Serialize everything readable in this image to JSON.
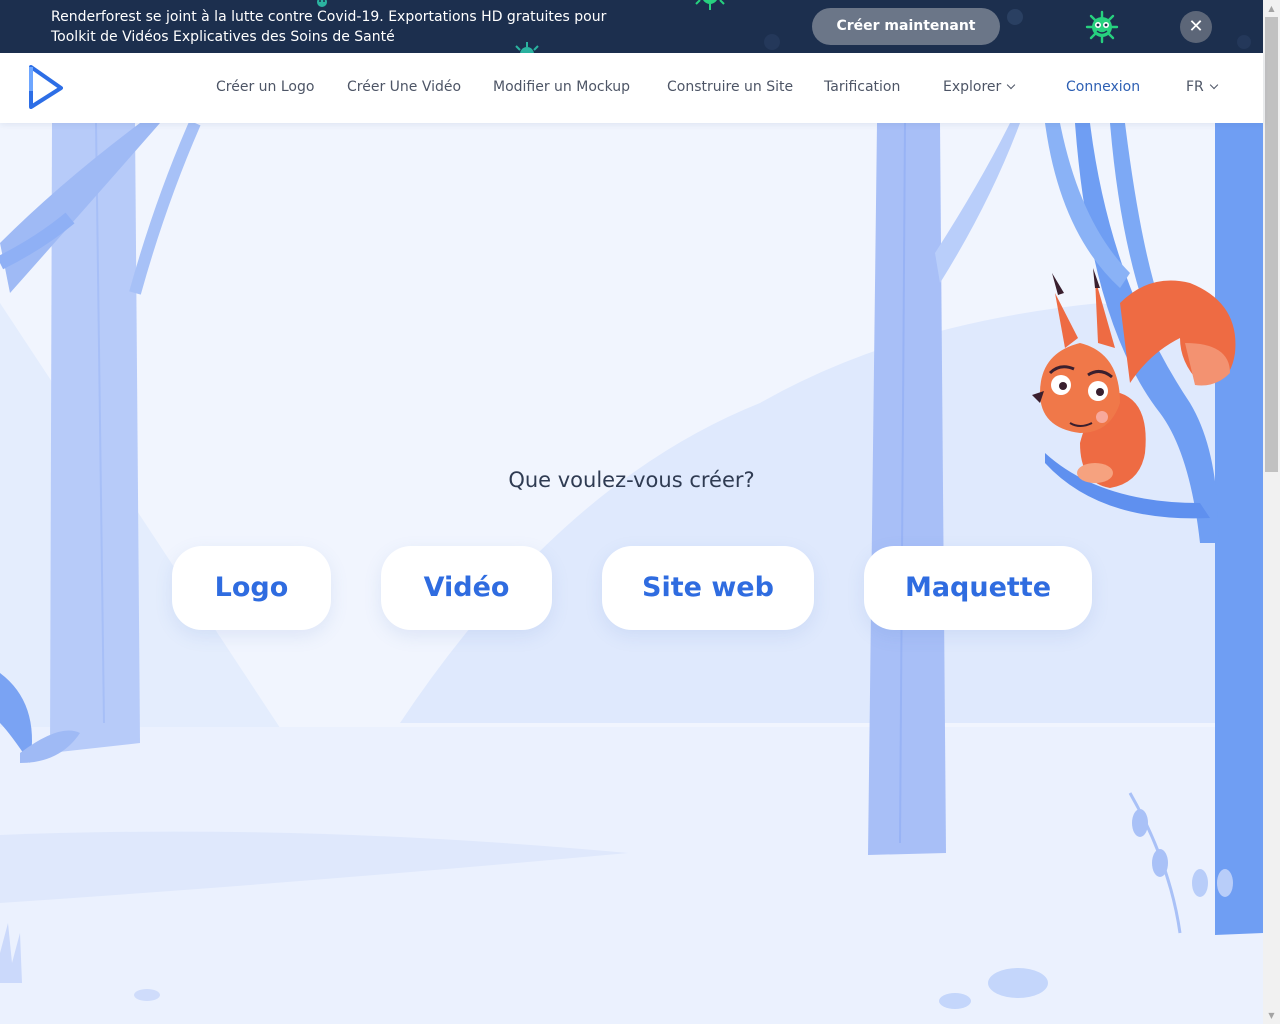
{
  "banner": {
    "text": "Renderforest se joint à la lutte contre Covid-19. Exportations HD gratuites pour Toolkit de Vidéos Explicatives des Soins de Santé",
    "cta_label": "Créer maintenant",
    "close_glyph": "✕"
  },
  "nav": {
    "items": [
      {
        "label": "Créer un Logo"
      },
      {
        "label": "Créer Une Vidéo"
      },
      {
        "label": "Modifier un Mockup"
      },
      {
        "label": "Construire un Site"
      },
      {
        "label": "Tarification"
      },
      {
        "label": "Explorer"
      }
    ],
    "login_label": "Connexion",
    "language_label": "FR"
  },
  "hero": {
    "question": "Que voulez-vous créer?",
    "choices": [
      {
        "label": "Logo"
      },
      {
        "label": "Vidéo"
      },
      {
        "label": "Site web"
      },
      {
        "label": "Maquette"
      }
    ]
  },
  "colors": {
    "banner_bg": "#1c2f4e",
    "accent": "#2f6ce0",
    "tree": "#9fb8f5",
    "squirrel": "#ef6f43"
  },
  "icons": {
    "logo": "renderforest-play-logo-icon",
    "close": "close-icon",
    "chevron": "chevron-down-icon",
    "virus": "virus-icon"
  }
}
